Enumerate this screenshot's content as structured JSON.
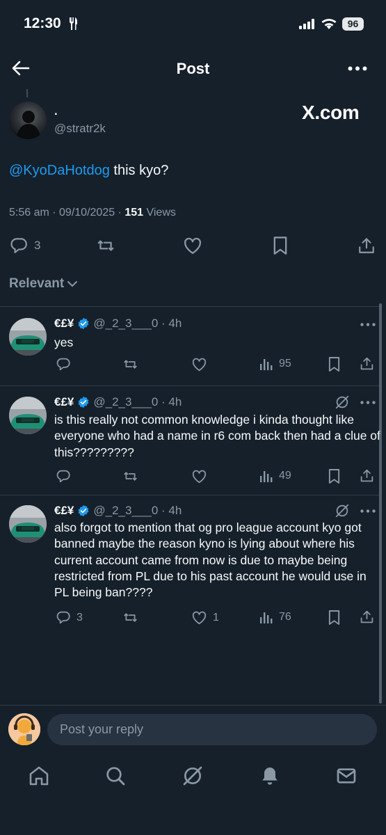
{
  "status_bar": {
    "time": "12:30",
    "battery": "96"
  },
  "header": {
    "title": "Post"
  },
  "post": {
    "author_name": ".",
    "author_handle": "@stratr2k",
    "watermark": "X.com",
    "mention": "@KyoDaHotdog",
    "text": " this kyo?",
    "timestamp": "5:56 am · 09/10/2025 · ",
    "views_count": "151",
    "views_label": " Views",
    "reply_count": "3"
  },
  "sort": {
    "label": "Relevant"
  },
  "replies": [
    {
      "name": "€£¥",
      "handle": "@_2_3___0 · 4h",
      "text": "yes",
      "reply_count": "",
      "like_count": "",
      "view_count": "95"
    },
    {
      "name": "€£¥",
      "handle": "@_2_3___0 · 4h",
      "text": "is this really not common knowledge i kinda thought like everyone who had a name in r6 com back then had a clue of this?????????",
      "reply_count": "",
      "like_count": "",
      "view_count": "49"
    },
    {
      "name": "€£¥",
      "handle": "@_2_3___0 · 4h",
      "text": "also forgot to mention that og pro league account kyo got banned maybe the reason kyno is lying about where his current account came from now is due to maybe being restricted from PL due to his past account he would use in PL being ban????",
      "reply_count": "3",
      "like_count": "1",
      "view_count": "76"
    }
  ],
  "composer": {
    "placeholder": "Post your reply"
  },
  "tab_bar": [
    "home-icon",
    "search-icon",
    "grok-icon",
    "notifications-icon",
    "messages-icon"
  ],
  "colors": {
    "background": "#15202b",
    "accent": "#1d9bf0",
    "muted": "#8b98a5",
    "verified": "#1d9bf0"
  }
}
